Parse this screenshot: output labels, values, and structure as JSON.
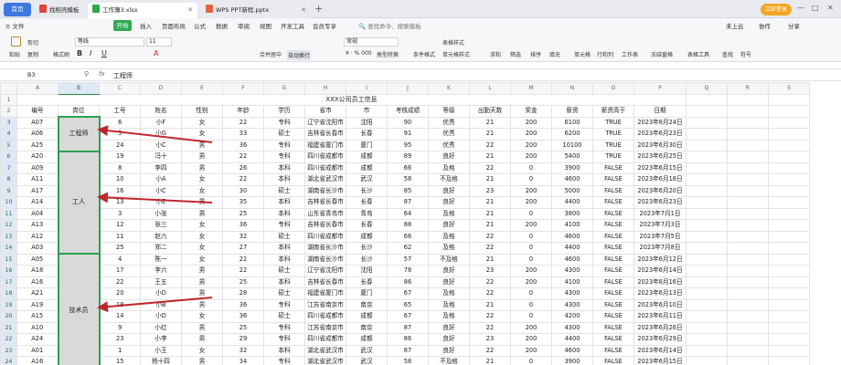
{
  "tabs": {
    "home": "首页",
    "doc1": "找稻壳模板",
    "doc2": "工作簿3.xlsx",
    "doc3": "WPS PPT新程.pptx",
    "new_tab": "+"
  },
  "login": "立即登录",
  "window_controls": [
    "—",
    "□",
    "✕"
  ],
  "menu": {
    "file": "≡ 文件",
    "items": [
      "开始",
      "插入",
      "页面布局",
      "公式",
      "数据",
      "审阅",
      "视图",
      "开发工具",
      "会员专享"
    ],
    "search": "查找命令、搜索模板",
    "cloud": "未上云",
    "collab": "协作",
    "share": "分享"
  },
  "ribbon": {
    "paste": "粘贴",
    "cut": "剪切",
    "copy": "复制",
    "format_painter": "格式刷",
    "font": "等线",
    "font_size": "11",
    "number_format": "常规",
    "merge": "合并居中",
    "wrap": "自动换行",
    "currency": "¥ · % 000",
    "convert": "类型转换",
    "cond": "条件格式",
    "table_style": "表格样式",
    "cell_style": "单元格样式",
    "sum": "求和",
    "filter": "筛选",
    "sort": "排序",
    "fill": "填充",
    "cell": "单元格",
    "rowcol": "行和列",
    "sheet": "工作表",
    "freeze": "冻结窗格",
    "table_tools": "表格工具",
    "find": "查找",
    "symbol": "符号"
  },
  "formula_bar": {
    "cell_ref": "B3",
    "fx": "fx",
    "value": "工程师"
  },
  "columns": [
    "A",
    "B",
    "C",
    "D",
    "E",
    "F",
    "G",
    "H",
    "I",
    "J",
    "K",
    "L",
    "M",
    "N",
    "O",
    "P",
    "Q",
    "R",
    "S"
  ],
  "sheet_title": "XXX公司员工信息",
  "headers": [
    "编号",
    "岗位",
    "工号",
    "姓名",
    "性别",
    "年龄",
    "学历",
    "省市",
    "市",
    "考核成绩",
    "等级",
    "出勤天数",
    "奖金",
    "薪资",
    "薪资高于",
    "日期"
  ],
  "groups": [
    {
      "label": "工程师",
      "rows": 3
    },
    {
      "label": "工人",
      "rows": 9
    },
    {
      "label": "技术员",
      "rows": 10
    }
  ],
  "rows": [
    [
      "A07",
      "6",
      "小F",
      "女",
      "22",
      "专科",
      "辽宁省沈阳市",
      "沈阳",
      "90",
      "优秀",
      "21",
      "200",
      "6100",
      "TRUE",
      "2023年6月24日"
    ],
    [
      "A06",
      "5",
      "小G",
      "女",
      "33",
      "硕士",
      "吉林省长春市",
      "长春",
      "91",
      "优秀",
      "21",
      "200",
      "6200",
      "TRUE",
      "2023年6月23日"
    ],
    [
      "A25",
      "24",
      "小C",
      "男",
      "36",
      "专科",
      "福建省厦门市",
      "厦门",
      "95",
      "优秀",
      "22",
      "200",
      "10100",
      "TRUE",
      "2023年6月30日"
    ],
    [
      "A20",
      "19",
      "冯十",
      "男",
      "22",
      "专科",
      "四川省成都市",
      "成都",
      "89",
      "良好",
      "21",
      "200",
      "5400",
      "TRUE",
      "2023年6月25日"
    ],
    [
      "A09",
      "8",
      "李四",
      "男",
      "26",
      "本科",
      "四川省成都市",
      "成都",
      "66",
      "及格",
      "22",
      "0",
      "3900",
      "FALSE",
      "2023年6月15日"
    ],
    [
      "A11",
      "10",
      "小A",
      "女",
      "22",
      "本科",
      "湖北省武汉市",
      "武汉",
      "58",
      "不及格",
      "21",
      "0",
      "4600",
      "FALSE",
      "2023年6月18日"
    ],
    [
      "A17",
      "16",
      "小C",
      "女",
      "30",
      "硕士",
      "湖南省长沙市",
      "长沙",
      "85",
      "良好",
      "23",
      "200",
      "5000",
      "FALSE",
      "2023年6月20日"
    ],
    [
      "A14",
      "13",
      "小E",
      "男",
      "35",
      "本科",
      "吉林省长春市",
      "长春",
      "87",
      "良好",
      "21",
      "200",
      "4400",
      "FALSE",
      "2023年6月23日"
    ],
    [
      "A04",
      "3",
      "小张",
      "男",
      "25",
      "本科",
      "山东省青岛市",
      "青岛",
      "64",
      "及格",
      "21",
      "0",
      "3800",
      "FALSE",
      "2023年7月1日"
    ],
    [
      "A13",
      "12",
      "张三",
      "女",
      "36",
      "专科",
      "吉林省长春市",
      "长春",
      "88",
      "良好",
      "21",
      "200",
      "4100",
      "FALSE",
      "2023年7月3日"
    ],
    [
      "A12",
      "11",
      "赵六",
      "女",
      "32",
      "硕士",
      "四川省成都市",
      "成都",
      "66",
      "及格",
      "22",
      "0",
      "4600",
      "FALSE",
      "2023年7月5日"
    ],
    [
      "A03",
      "25",
      "郑二",
      "女",
      "27",
      "本科",
      "湖南省长沙市",
      "长沙",
      "62",
      "及格",
      "22",
      "0",
      "4400",
      "FALSE",
      "2023年7月8日"
    ],
    [
      "A05",
      "4",
      "陈一",
      "女",
      "22",
      "本科",
      "湖南省长沙市",
      "长沙",
      "57",
      "不及格",
      "21",
      "0",
      "4600",
      "FALSE",
      "2023年6月12日"
    ],
    [
      "A18",
      "17",
      "李六",
      "男",
      "22",
      "硕士",
      "辽宁省沈阳市",
      "沈阳",
      "78",
      "良好",
      "23",
      "200",
      "4300",
      "FALSE",
      "2023年6月14日"
    ],
    [
      "A16",
      "22",
      "王五",
      "男",
      "25",
      "本科",
      "吉林省长春市",
      "长春",
      "86",
      "良好",
      "22",
      "200",
      "4100",
      "FALSE",
      "2023年6月16日"
    ],
    [
      "A21",
      "20",
      "小D",
      "男",
      "28",
      "硕士",
      "福建省厦门市",
      "厦门",
      "67",
      "及格",
      "22",
      "0",
      "4300",
      "FALSE",
      "2023年6月13日"
    ],
    [
      "A19",
      "18",
      "小B",
      "男",
      "36",
      "专科",
      "江苏省南京市",
      "南京",
      "65",
      "及格",
      "21",
      "0",
      "4300",
      "FALSE",
      "2023年6月10日"
    ],
    [
      "A15",
      "14",
      "小D",
      "女",
      "36",
      "硕士",
      "四川省成都市",
      "成都",
      "67",
      "及格",
      "22",
      "0",
      "4200",
      "FALSE",
      "2023年6月11日"
    ],
    [
      "A10",
      "9",
      "小红",
      "男",
      "25",
      "专科",
      "江苏省南京市",
      "南京",
      "87",
      "良好",
      "22",
      "200",
      "4300",
      "FALSE",
      "2023年6月26日"
    ],
    [
      "A24",
      "23",
      "小李",
      "男",
      "29",
      "专科",
      "四川省成都市",
      "成都",
      "86",
      "良好",
      "23",
      "200",
      "4400",
      "FALSE",
      "2023年6月29日"
    ],
    [
      "A01",
      "1",
      "小王",
      "女",
      "32",
      "本科",
      "湖北省武汉市",
      "武汉",
      "87",
      "良好",
      "22",
      "200",
      "4600",
      "FALSE",
      "2023年6月14日"
    ],
    [
      "A16",
      "15",
      "杨十四",
      "男",
      "34",
      "专科",
      "湖北省武汉市",
      "武汉",
      "58",
      "不及格",
      "21",
      "0",
      "3900",
      "FALSE",
      "2023年6月15日"
    ]
  ],
  "row_numbers": [
    "1",
    "2",
    "3",
    "4",
    "5",
    "6",
    "7",
    "8",
    "9",
    "10",
    "11",
    "12",
    "13",
    "14",
    "15",
    "16",
    "17",
    "18",
    "19",
    "20",
    "21",
    "22",
    "23",
    "24"
  ],
  "arrow_color": "#c0282d",
  "accent_green": "#2e9e52"
}
